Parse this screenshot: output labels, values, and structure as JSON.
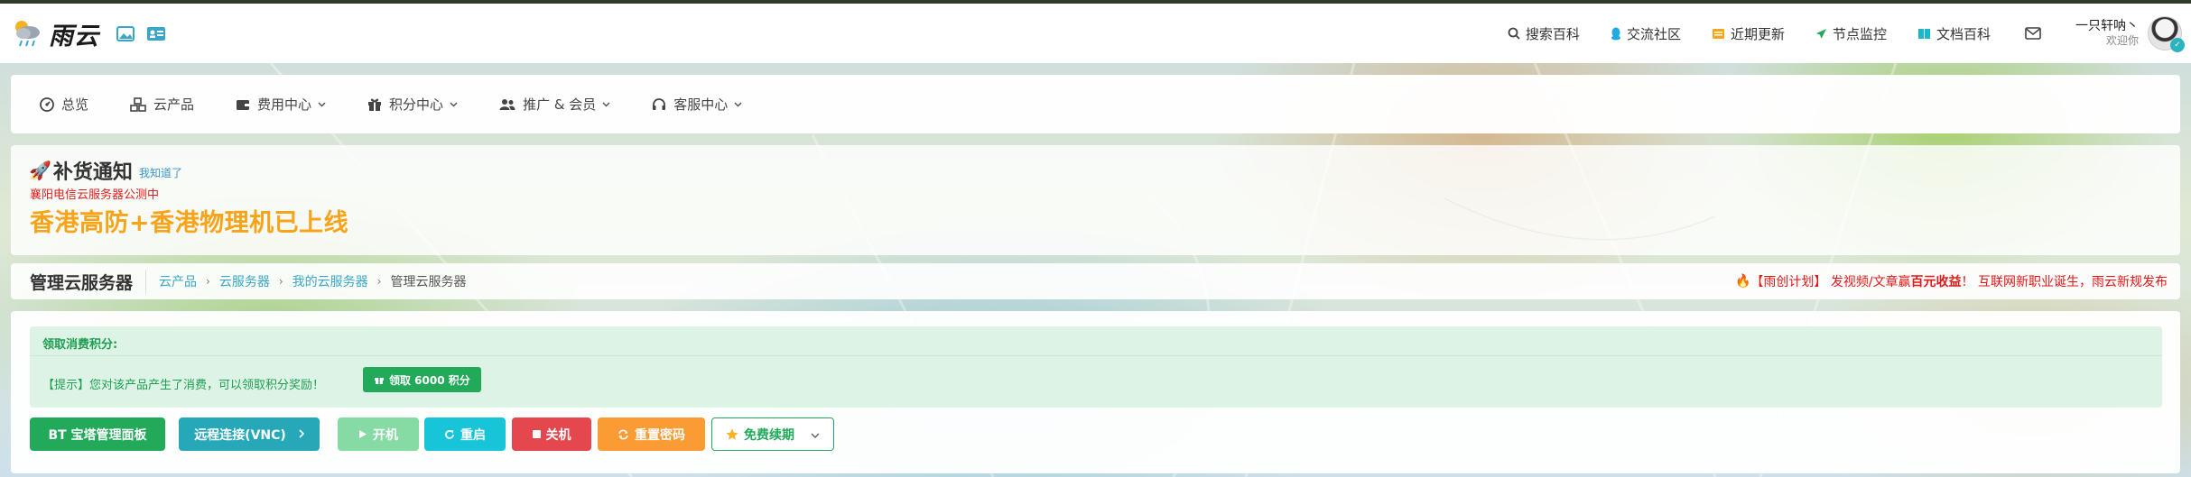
{
  "header": {
    "logo_text": "雨云",
    "nav": [
      {
        "label": "搜索百科",
        "icon": "search-icon"
      },
      {
        "label": "交流社区",
        "icon": "qq-icon"
      },
      {
        "label": "近期更新",
        "icon": "calendar-icon"
      },
      {
        "label": "节点监控",
        "icon": "send-icon"
      },
      {
        "label": "文档百科",
        "icon": "book-icon"
      }
    ],
    "user_name": "一只轩呐丶",
    "welcome": "欢迎你"
  },
  "main_nav": [
    {
      "label": "总览",
      "icon": "dashboard-icon",
      "dropdown": false
    },
    {
      "label": "云产品",
      "icon": "cubes-icon",
      "dropdown": false
    },
    {
      "label": "费用中心",
      "icon": "wallet-icon",
      "dropdown": true
    },
    {
      "label": "积分中心",
      "icon": "gift-icon",
      "dropdown": true
    },
    {
      "label": "推广 & 会员",
      "icon": "users-icon",
      "dropdown": true
    },
    {
      "label": "客服中心",
      "icon": "headset-icon",
      "dropdown": true
    }
  ],
  "notice": {
    "title": "补货通知",
    "ack": "我知道了",
    "sub": "襄阳电信云服务器公测中",
    "main": "香港高防+香港物理机已上线"
  },
  "breadcrumb": {
    "title": "管理云服务器",
    "items": [
      "云产品",
      "云服务器",
      "我的云服务器",
      "管理云服务器"
    ],
    "marquee_prefix": "【雨创计划】 发视频/文章赢",
    "marquee_bold": "百元收益",
    "marquee_suffix": "！ 互联网新职业诞生，雨云新规发布"
  },
  "claim": {
    "heading": "领取消费积分:",
    "tip": "【提示】您对该产品产生了消费，可以领取积分奖励！",
    "button": "领取 6000 积分"
  },
  "actions": {
    "bt_panel": "BT 宝塔管理面板",
    "vnc": "远程连接(VNC)",
    "power_on": "开机",
    "reboot": "重启",
    "power_off": "关机",
    "reset_password": "重置密码",
    "renew": "免费续期"
  },
  "colors": {
    "primary_green": "#22a95a",
    "teal": "#26a8b9",
    "cyan": "#18c4d8",
    "danger": "#e5474f",
    "warning": "#fa9b34",
    "notice_orange": "#f7a41b",
    "notice_red": "#e02020",
    "link_blue": "#3aa6c7"
  }
}
